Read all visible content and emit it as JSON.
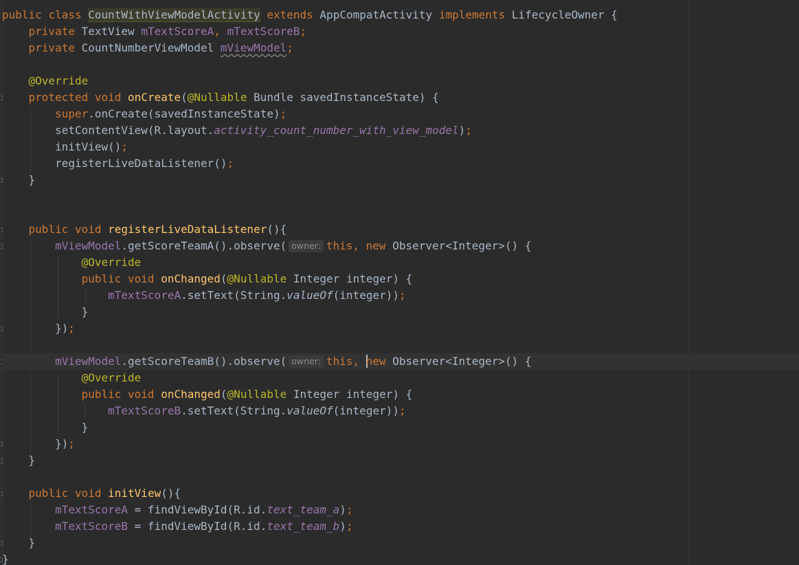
{
  "colors": {
    "background": "#2b2b2b",
    "text": "#a9b7c6",
    "keyword": "#cc7832",
    "field": "#9876aa",
    "annotation": "#bbb529",
    "method_declaration": "#ffc66d",
    "hint_background": "#3b3b3b",
    "hint_text": "#8c8c8c"
  },
  "code": {
    "public": "public",
    "class": "class",
    "class_name": "CountWithViewModelActivity",
    "extends": "extends",
    "super_class": "AppCompatActivity",
    "implements": "implements",
    "interface_name": "LifecycleOwner",
    "open_brace": " {",
    "close_brace": "}",
    "private": "private",
    "textview_type": "TextView",
    "field_a": "mTextScoreA",
    "comma": ",",
    "field_b": "mTextScoreB",
    "semicolon": ";",
    "viewmodel_type": "CountNumberViewModel",
    "field_vm": "mViewModel",
    "override_annotation": "@Override",
    "protected": "protected",
    "void": "void",
    "on_create": "onCreate",
    "nullable_annotation": "@Nullable",
    "bundle_params": " Bundle savedInstanceState) {",
    "super": "super",
    "super_call": ".onCreate(savedInstanceState)",
    "set_content_view": "setContentView(R.layout.",
    "layout_name": "activity_count_number_with_view_model",
    "close_paren": ")",
    "init_view_call": "initView()",
    "register_call": "registerLiveDataListener()",
    "register_decl": "registerLiveDataListener",
    "paren_open_brace": "(){",
    "get_score_a_observe": ".getScoreTeamA().observe(",
    "get_score_b_observe": ".getScoreTeamB().observe(",
    "hint_owner": "owner:",
    "this": "this",
    "new": "new",
    "observer_generic": " Observer<Integer>() {",
    "on_changed": "onChanged",
    "paren_open": "(",
    "integer_params": " Integer integer) {",
    "set_text_value_of": ".setText(String.",
    "value_of": "valueOf",
    "integer_close": "(integer))",
    "close_observer": "})",
    "init_view_decl": "initView",
    "equals_find": " = findViewById(R.id.",
    "text_team_a": "text_team_a",
    "text_team_b": "text_team_b"
  }
}
